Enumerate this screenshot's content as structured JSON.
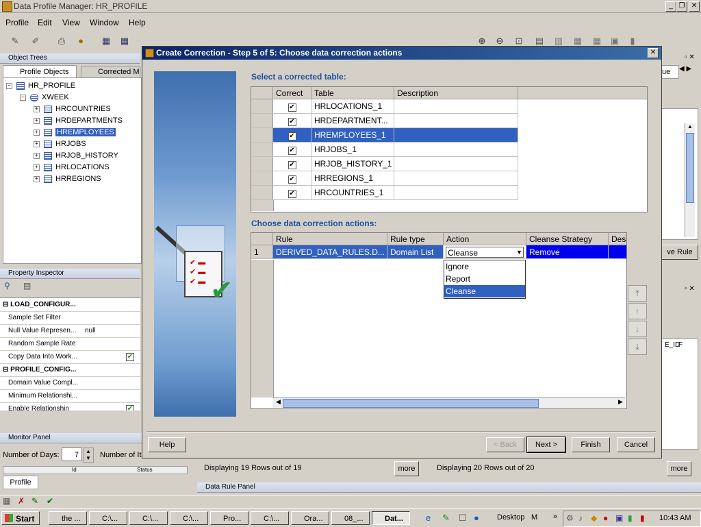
{
  "window": {
    "title": "Data Profile Manager: HR_PROFILE"
  },
  "menu": [
    "Profile",
    "Edit",
    "View",
    "Window",
    "Help"
  ],
  "object_trees": {
    "header": "Object Trees",
    "tabs": [
      "Profile Objects",
      "Corrected M"
    ],
    "root": "HR_PROFILE",
    "module": "XWEEK",
    "items": [
      "HRCOUNTRIES",
      "HRDEPARTMENTS",
      "HREMPLOYEES",
      "HRJOBS",
      "HRJOB_HISTORY",
      "HRLOCATIONS",
      "HRREGIONS"
    ]
  },
  "property_inspector": {
    "header": "Property Inspector",
    "rows": [
      {
        "key": "LOAD_CONFIGUR...",
        "value": "",
        "section": true
      },
      {
        "key": "Sample Set Filter",
        "value": ""
      },
      {
        "key": "Null Value Represen...",
        "value": "null"
      },
      {
        "key": "Random Sample Rate",
        "value": ""
      },
      {
        "key": "Copy Data Into Work...",
        "value": "✔"
      },
      {
        "key": "PROFILE_CONFIG...",
        "value": "",
        "section": true
      },
      {
        "key": "Domain Value Compl...",
        "value": ""
      },
      {
        "key": "Minimum Relationshi...",
        "value": ""
      },
      {
        "key": "Enable Relationshin",
        "value": "✔"
      }
    ]
  },
  "monitor_panel": {
    "header": "Monitor Panel",
    "days_label": "Number of Days:",
    "days_value": "7",
    "items_label": "Number of It",
    "col1": "Id",
    "col2": "Status",
    "tab": "Profile"
  },
  "right_panel": {
    "tab_fragment": "ue",
    "button_fragment": "ve Rule",
    "col_fragment": "E_ID",
    "col_fragment2": "F",
    "footer": "Data Rule Panel"
  },
  "status": {
    "left_text": "Displaying 19 Rows out of 19",
    "right_text": "Displaying 20 Rows out of 20",
    "more": "more"
  },
  "dialog": {
    "title": "Create Correction - Step 5 of 5: Choose data correction actions",
    "section1": "Select a corrected table:",
    "table1": {
      "headers": [
        "Correct",
        "Table",
        "Description"
      ],
      "rows": [
        {
          "checked": "✔",
          "table": "HRLOCATIONS_1",
          "desc": ""
        },
        {
          "checked": "✔",
          "table": "HRDEPARTMENT...",
          "desc": ""
        },
        {
          "checked": "✔",
          "table": "HREMPLOYEES_1",
          "desc": ""
        },
        {
          "checked": "✔",
          "table": "HRJOBS_1",
          "desc": ""
        },
        {
          "checked": "✔",
          "table": "HRJOB_HISTORY_1",
          "desc": ""
        },
        {
          "checked": "✔",
          "table": "HRREGIONS_1",
          "desc": ""
        },
        {
          "checked": "✔",
          "table": "HRCOUNTRIES_1",
          "desc": ""
        }
      ]
    },
    "section2": "Choose data correction actions:",
    "table2": {
      "headers": [
        "Rule",
        "Rule type",
        "Action",
        "Cleanse Strategy",
        "Des"
      ],
      "row": {
        "num": "1",
        "rule": "DERIVED_DATA_RULES.D...",
        "type": "Domain List",
        "action": "Cleanse",
        "strategy": "Remove"
      }
    },
    "dropdown_options": [
      "Ignore",
      "Report",
      "Cleanse"
    ],
    "buttons": {
      "help": "Help",
      "back": "< Back",
      "next": "Next >",
      "finish": "Finish",
      "cancel": "Cancel"
    }
  },
  "taskbar": {
    "start": "Start",
    "tasks": [
      "the ...",
      "C:\\...",
      "C:\\...",
      "C:\\...",
      "Pro...",
      "C:\\...",
      "Ora...",
      "08_...",
      "Dat..."
    ],
    "desktop": "Desktop",
    "m": "M",
    "clock": "10:43 AM"
  }
}
